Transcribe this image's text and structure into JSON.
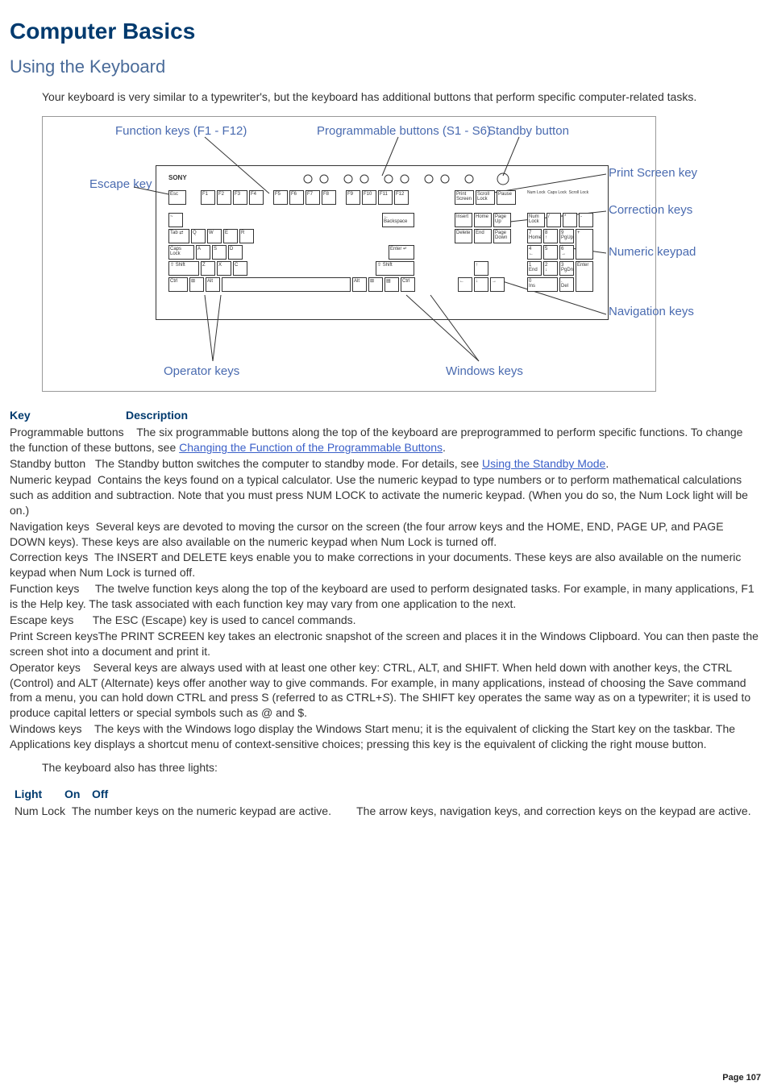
{
  "title": "Computer Basics",
  "subtitle": "Using the Keyboard",
  "intro": "Your keyboard is very similar to a typewriter's, but the keyboard has additional buttons that perform specific computer-related tasks.",
  "diagram_labels": {
    "fkeys": "Function keys (F1 - F12)",
    "pbuttons": "Programmable buttons (S1 - S6)",
    "standby": "Standby button",
    "escape": "Escape key",
    "prtscr": "Print Screen key",
    "correction": "Correction keys",
    "numkp": "Numeric keypad",
    "nav": "Navigation keys",
    "operator": "Operator keys",
    "winkeys": "Windows keys"
  },
  "table1_header_key": "Key",
  "table1_header_desc": "Description",
  "rows": {
    "r1k": "Programmable buttons",
    "r1d": "The six programmable buttons along the top of the keyboard are preprogrammed to perform specific functions. To change the function of these buttons, see ",
    "r1link": "Changing the Function of the Programmable Buttons",
    "r1d2": ".",
    "r2k": "Standby button",
    "r2d": "The Standby button switches the computer to standby mode. For details, see ",
    "r2link": "Using the Standby Mode",
    "r2d2": ".",
    "r3k": "Numeric keypad",
    "r3d": "Contains the keys found on a typical calculator. Use the numeric keypad to type numbers or to perform mathematical calculations such as addition and subtraction. Note that you must press NUM LOCK to activate the numeric keypad. (When you do so, the Num Lock light will be on.)",
    "r4k": "Navigation keys",
    "r4d": "Several keys are devoted to moving the cursor on the screen (the four arrow keys and the HOME, END, PAGE UP, and PAGE DOWN keys). These keys are also available on the numeric keypad when Num Lock is turned off.",
    "r5k": "Correction keys",
    "r5d": "The INSERT and DELETE keys enable you to make corrections in your documents. These keys are also available on the numeric keypad when Num Lock is turned off.",
    "r6k": "Function keys",
    "r6d": "The twelve function keys along the top of the keyboard are used to perform designated tasks. For example, in many applications, F1 is the Help key. The task associated with each function key may vary from one application to the next.",
    "r7k": "Escape keys",
    "r7d": "The ESC (Escape) key is used to cancel commands.",
    "r8k": "Print Screen keys",
    "r8d": "The PRINT SCREEN key takes an electronic snapshot of the screen and places it in the Windows Clipboard. You can then paste the screen shot into a document and print it.",
    "r9k": "Operator keys",
    "r9d1": "Several keys are always used with at least one other key: CTRL, ALT, and SHIFT. When held down with another keys, the CTRL (Control) and ALT (Alternate) keys offer another way to give commands. For example, in many applications, instead of choosing the Save command from a menu, you can hold down CTRL and press S (referred to as CTRL+",
    "r9i": "S",
    "r9d2": "). The SHIFT key operates the same way as on a typewriter; it is used to produce capital letters or special symbols such as @ and $.",
    "r10k": "Windows keys",
    "r10d": "The keys with the Windows logo display the Windows Start menu; it is the equivalent of clicking the Start key on the taskbar. The Applications key displays a shortcut menu of context-sensitive choices; pressing this key is the equivalent of clicking the right mouse button."
  },
  "mid": "The keyboard also has three lights:",
  "table2_header_light": "Light",
  "table2_header_on": "On",
  "table2_header_off": "Off",
  "lights": {
    "l1k": "Num Lock",
    "l1on": "The number keys on the numeric keypad are active.",
    "l1off": "The arrow keys, navigation keys, and correction keys on the keypad are active."
  },
  "footer": "Page 107"
}
